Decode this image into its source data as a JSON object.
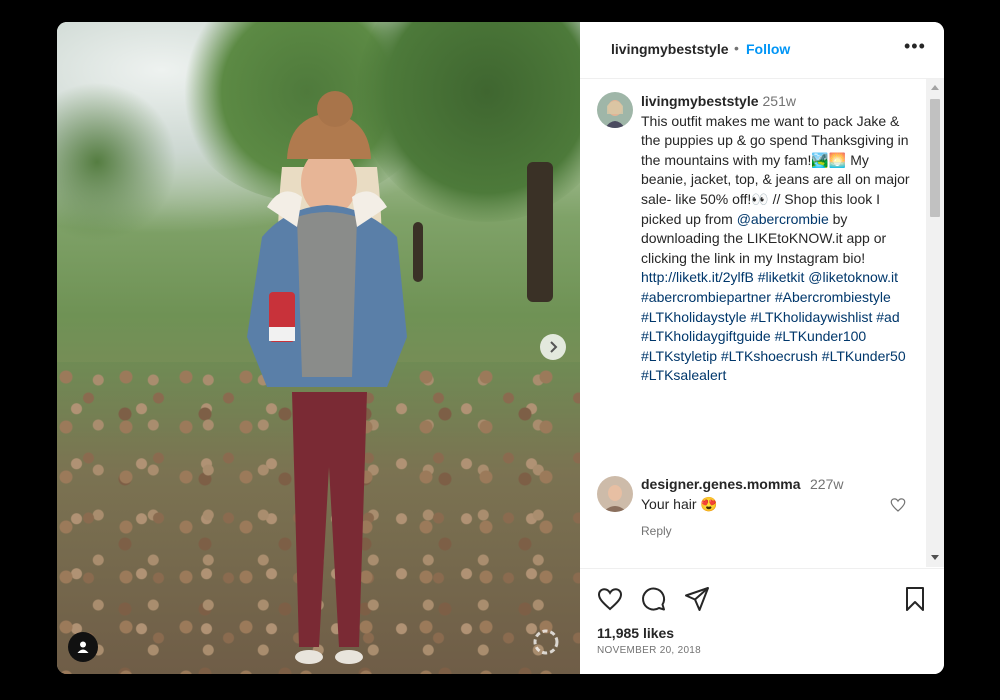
{
  "post": {
    "username": "livingmybeststyle",
    "follow_label": "Follow",
    "dot": "•",
    "more_label": "•••"
  },
  "caption": {
    "username": "livingmybeststyle",
    "time": "251w",
    "text": "This outfit makes me want to pack Jake & the puppies up & go spend Thanksgiving in the mountains with my fam!🏞️🌅 My beanie, jacket, top, & jeans are all on major sale- like 50% off!👀 // Shop this look I picked up from @abercrombie by downloading the LIKEtoKNOW.it app or clicking the link in my Instagram bio! http://liketk.it/2ylfB #liketkit @liketoknow.it #abercrombiepartner #Abercrombiestyle #LTKholidaystyle #LTKholidaywishlist #ad #LTKholidaygiftguide #LTKunder100 #LTKstyletip #LTKshoecrush #LTKunder50 #LTKsalealert"
  },
  "comment": {
    "username": "designer.genes.momma",
    "time": "227w",
    "text": "Your hair 😍",
    "reply_label": "Reply"
  },
  "stats": {
    "likes": "11,985 likes",
    "date": "NOVEMBER 20, 2018"
  },
  "icons": [
    "heart-icon",
    "comment-icon",
    "share-icon",
    "bookmark-icon",
    "chevron-right-icon",
    "user-icon",
    "more-icon"
  ],
  "colors": {
    "follow_blue": "#0095f6",
    "hashtag": "#00376b",
    "text": "#262626",
    "muted": "#737373",
    "backdrop": "#000000"
  }
}
